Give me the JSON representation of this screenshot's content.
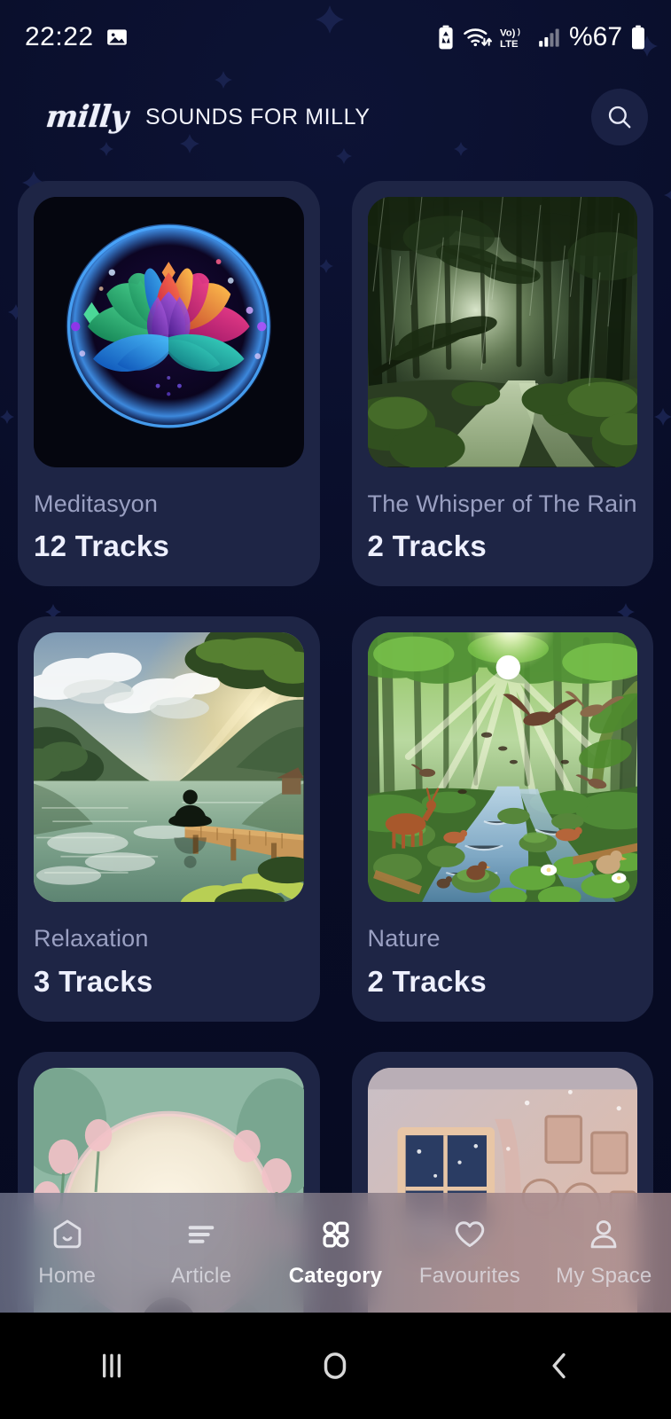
{
  "status_bar": {
    "time": "22:22",
    "battery_percent": "%67",
    "icons": [
      "screenshot-icon",
      "battery-saver-icon",
      "wifi-icon",
      "volte-icon",
      "signal-icon",
      "battery-icon"
    ]
  },
  "header": {
    "brand": "milly",
    "title": "SOUNDS FOR MILLY",
    "search_icon": "search-icon"
  },
  "categories": [
    {
      "name": "Meditasyon",
      "tracks": "12 Tracks",
      "art": "lotus"
    },
    {
      "name": "The Whisper of The Rain",
      "tracks": "2 Tracks",
      "art": "rainforest"
    },
    {
      "name": "Relaxation",
      "tracks": "3 Tracks",
      "art": "lake"
    },
    {
      "name": "Nature",
      "tracks": "2 Tracks",
      "art": "stream"
    },
    {
      "name": "",
      "tracks": "",
      "art": "moonflowers"
    },
    {
      "name": "",
      "tracks": "",
      "art": "cozyroom"
    }
  ],
  "bottom_nav": {
    "active": "Category",
    "items": [
      {
        "label": "Home",
        "icon": "home-icon"
      },
      {
        "label": "Article",
        "icon": "article-icon"
      },
      {
        "label": "Category",
        "icon": "category-icon"
      },
      {
        "label": "Favourites",
        "icon": "heart-icon"
      },
      {
        "label": "My Space",
        "icon": "person-icon"
      }
    ]
  },
  "system_nav": {
    "recent": "recent-apps-icon",
    "home": "home-circle-icon",
    "back": "back-chevron-icon"
  },
  "colors": {
    "page_bg": "#070b24",
    "card_bg": "#1e2545",
    "title_muted": "#9aa0c2",
    "count_bright": "#eef0ff"
  }
}
